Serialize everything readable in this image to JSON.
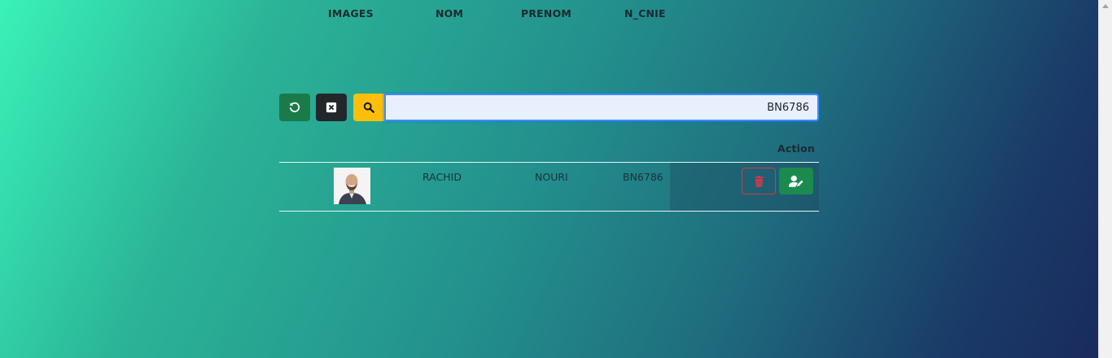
{
  "toolbar": {
    "refresh_icon": "rotate-left-icon",
    "clear_icon": "square-x-icon",
    "search_icon": "magnifier-icon",
    "search_value": "BN6786"
  },
  "table": {
    "headers": [
      "IMAGES",
      "NOM",
      "PRENOM",
      "N_CNIE",
      "Action"
    ],
    "rows": [
      {
        "nom": "RACHID",
        "prenom": "NOURI",
        "n_cnie": "BN6786",
        "actions": [
          "trash-icon",
          "user-edit-icon"
        ]
      }
    ]
  },
  "colors": {
    "refresh_button": "#1b7a4a",
    "clear_button": "#22272b",
    "search_button": "#fbbf0b",
    "delete_outline": "#dc3545",
    "edit_button": "#1b8a4f"
  }
}
